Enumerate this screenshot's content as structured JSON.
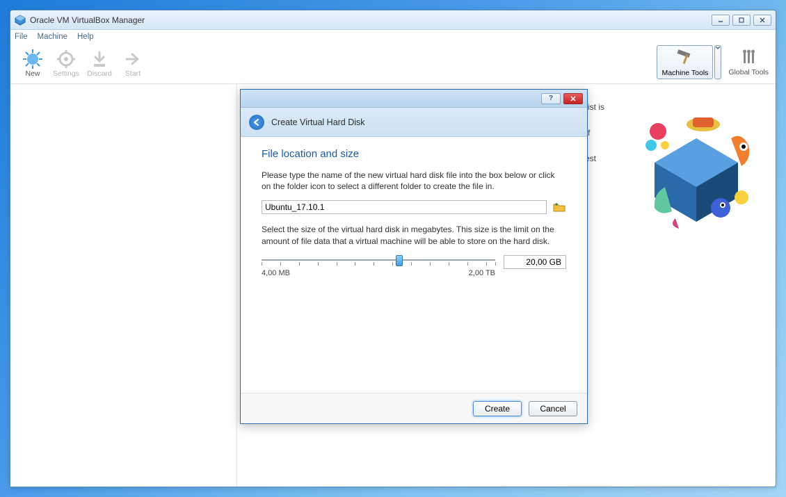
{
  "app": {
    "title": "Oracle VM VirtualBox Manager"
  },
  "menubar": [
    "File",
    "Machine",
    "Help"
  ],
  "toolbar": {
    "new": "New",
    "settings": "Settings",
    "discard": "Discard",
    "start": "Start",
    "machine_tools": "Machine Tools",
    "global_tools": "Global Tools"
  },
  "welcome": {
    "line1": "The list is",
    "line2": "top of",
    "line3": "d latest"
  },
  "dialog": {
    "title": "Create Virtual Hard Disk",
    "heading": "File location and size",
    "p1": "Please type the name of the new virtual hard disk file into the box below or click on the folder icon to select a different folder to create the file in.",
    "file_value": "Ubuntu_17.10.1",
    "p2": "Select the size of the virtual hard disk in megabytes. This size is the limit on the amount of file data that a virtual machine will be able to store on the hard disk.",
    "size_value": "20,00 GB",
    "min_label": "4,00 MB",
    "max_label": "2,00 TB",
    "slider_percent": 59,
    "create": "Create",
    "cancel": "Cancel",
    "help": "?"
  }
}
